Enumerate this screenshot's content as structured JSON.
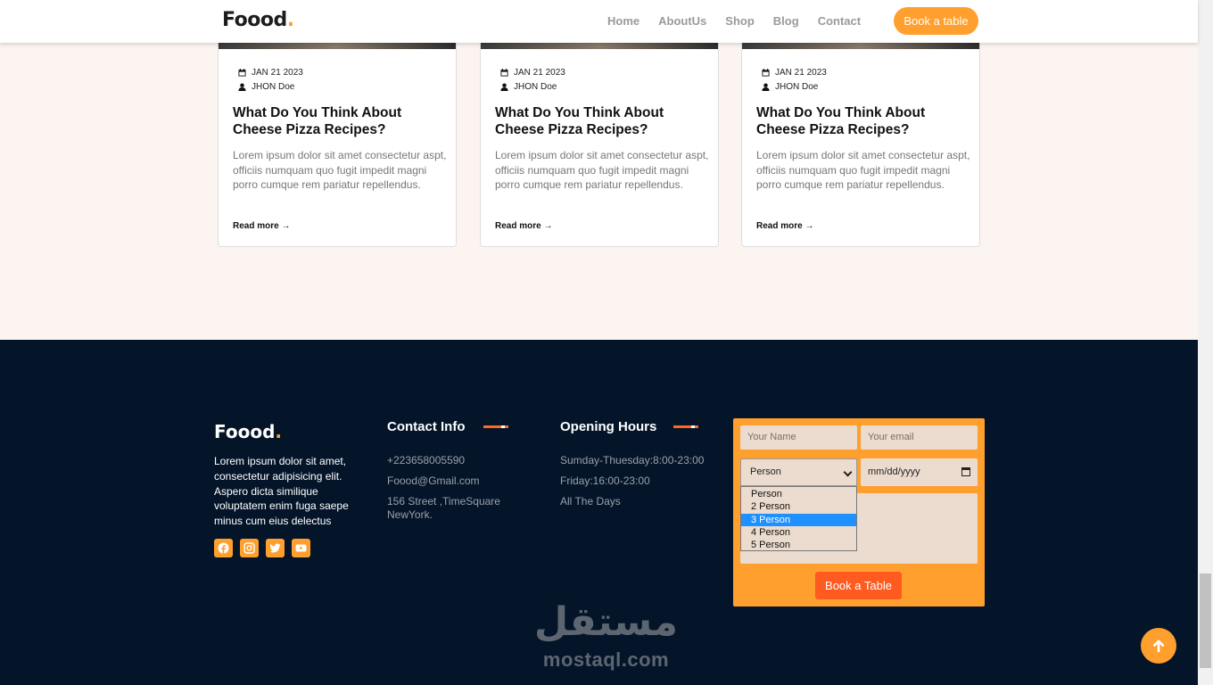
{
  "navbar": {
    "logo_text": "Foood",
    "logo_dot": ".",
    "links": [
      "Home",
      "AboutUs",
      "Shop",
      "Blog",
      "Contact"
    ],
    "cta_label": "Book a table"
  },
  "blog": {
    "cards": [
      {
        "date": "JAN 21 2023",
        "author": "JHON Doe",
        "title": "What Do You Think About Cheese Pizza Recipes?",
        "excerpt": "Lorem ipsum dolor sit amet consectetur aspt, officiis numquam quo fugit impedit magni porro cumque rem pariatur repellendus.",
        "read_more": "Read more"
      },
      {
        "date": "JAN 21 2023",
        "author": "JHON Doe",
        "title": "What Do You Think About Cheese Pizza Recipes?",
        "excerpt": "Lorem ipsum dolor sit amet consectetur aspt, officiis numquam quo fugit impedit magni porro cumque rem pariatur repellendus.",
        "read_more": "Read more"
      },
      {
        "date": "JAN 21 2023",
        "author": "JHON Doe",
        "title": "What Do You Think About Cheese Pizza Recipes?",
        "excerpt": "Lorem ipsum dolor sit amet consectetur aspt, officiis numquam quo fugit impedit magni porro cumque rem pariatur repellendus.",
        "read_more": "Read more"
      }
    ]
  },
  "footer": {
    "logo_text": "Foood",
    "logo_dot": ".",
    "about": "Lorem ipsum dolor sit amet, consectetur adipisicing elit. Aspero dicta similique voluptatem enim fuga saepe minus cum eius delectus",
    "socials": [
      "facebook-icon",
      "instagram-icon",
      "twitter-icon",
      "youtube-icon"
    ],
    "contact": {
      "title": "Contact Info",
      "phone": "+223658005590",
      "email": "Foood@Gmail.com",
      "address": "156 Street ,TimeSquare NewYork."
    },
    "hours": {
      "title": "Opening Hours",
      "weekday": "Sumday-Thuesday:8:00-23:00",
      "friday": "Friday:16:00-23:00",
      "all": "All The Days"
    },
    "form": {
      "name_placeholder": "Your Name",
      "email_placeholder": "Your email",
      "person_selected": "Person",
      "person_options": [
        "Person",
        "2 Person",
        "3 Person",
        "4 Person",
        "5 Person"
      ],
      "highlighted_option": "3 Person",
      "date_placeholder": "mm/dd/yyyy",
      "submit_label": "Book a Table"
    }
  },
  "watermark": {
    "arabic": "مستقل",
    "latin": "mostaql.com"
  },
  "colors": {
    "accent": "#ff9f2e",
    "footer_bg": "#04152a",
    "button_red": "#ff5a1f",
    "page_bg": "#fcf4f1"
  }
}
